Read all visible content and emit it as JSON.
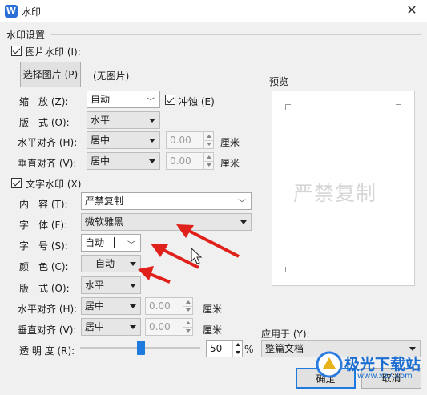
{
  "window": {
    "title": "水印",
    "close_icon": "close-icon"
  },
  "settings": {
    "section_title": "水印设置",
    "image_watermark": {
      "checkbox_label": "图片水印 (I):",
      "checked": true,
      "select_image_button": "选择图片 (P)",
      "no_image_text": "(无图片)",
      "scale": {
        "label": "缩　放 (Z):",
        "value": "自动"
      },
      "washout": {
        "label": "冲蚀 (E)",
        "checked": true
      },
      "layout": {
        "label": "版　式 (O):",
        "value": "水平"
      },
      "h_align": {
        "label": "水平对齐 (H):",
        "value": "居中",
        "offset": "0.00",
        "unit": "厘米"
      },
      "v_align": {
        "label": "垂直对齐 (V):",
        "value": "居中",
        "offset": "0.00",
        "unit": "厘米"
      }
    },
    "text_watermark": {
      "checkbox_label": "文字水印 (X)",
      "checked": true,
      "content": {
        "label": "内　容 (T):",
        "value": "严禁复制"
      },
      "font": {
        "label": "字　体 (F):",
        "value": "微软雅黑"
      },
      "size": {
        "label": "字　号 (S):",
        "value": "自动"
      },
      "color": {
        "label": "颜　色 (C):",
        "value": "自动"
      },
      "layout": {
        "label": "版　式 (O):",
        "value": "水平"
      },
      "h_align": {
        "label": "水平对齐 (H):",
        "value": "居中",
        "offset": "0.00",
        "unit": "厘米"
      },
      "v_align": {
        "label": "垂直对齐 (V):",
        "value": "居中",
        "offset": "0.00",
        "unit": "厘米"
      },
      "transparency": {
        "label": "透 明 度 (R):",
        "value": "50",
        "unit": "%",
        "level_percent": 50
      }
    }
  },
  "preview": {
    "title": "预览",
    "watermark_text": "严禁复制"
  },
  "apply_to": {
    "label": "应用于 (Y):",
    "value": "整篇文档"
  },
  "buttons": {
    "ok": "确定",
    "cancel": "取消"
  },
  "overlay_logo": {
    "text": "极光下载站",
    "url": "www.xz7.com"
  },
  "colors": {
    "accent": "#1f7ae0",
    "annotation_arrow": "#e0211b"
  }
}
